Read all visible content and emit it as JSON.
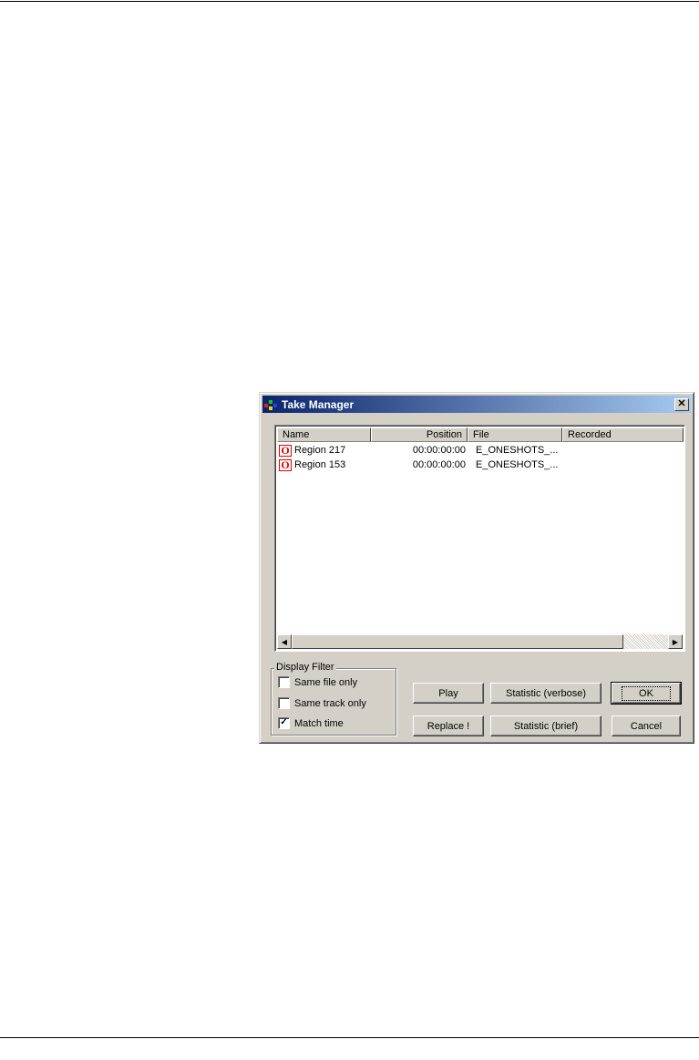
{
  "window": {
    "title": "Take Manager",
    "close_glyph": "✕"
  },
  "list": {
    "columns": [
      "Name",
      "Position",
      "File",
      "Recorded"
    ],
    "rows": [
      {
        "icon": "region-icon",
        "icon_glyph": "O",
        "name": "Region 217",
        "position": "00:00:00:00",
        "file": "E_ONESHOTS_...",
        "recorded": ""
      },
      {
        "icon": "region-icon",
        "icon_glyph": "O",
        "name": "Region 153",
        "position": "00:00:00:00",
        "file": "E_ONESHOTS_...",
        "recorded": ""
      }
    ]
  },
  "display_filter": {
    "label": "Display Filter",
    "options": [
      {
        "label": "Same file only",
        "checked": false
      },
      {
        "label": "Same track only",
        "checked": false
      },
      {
        "label": "Match time",
        "checked": true
      }
    ]
  },
  "buttons": {
    "play": "Play",
    "replace": "Replace !",
    "stat_verbose": "Statistic (verbose)",
    "stat_brief": "Statistic (brief)",
    "ok": "OK",
    "cancel": "Cancel"
  },
  "colors": {
    "titlebar_start": "#0a246a",
    "titlebar_end": "#a6caf0",
    "dialog_face": "#d4d0c8",
    "region_icon": "#e00000"
  }
}
